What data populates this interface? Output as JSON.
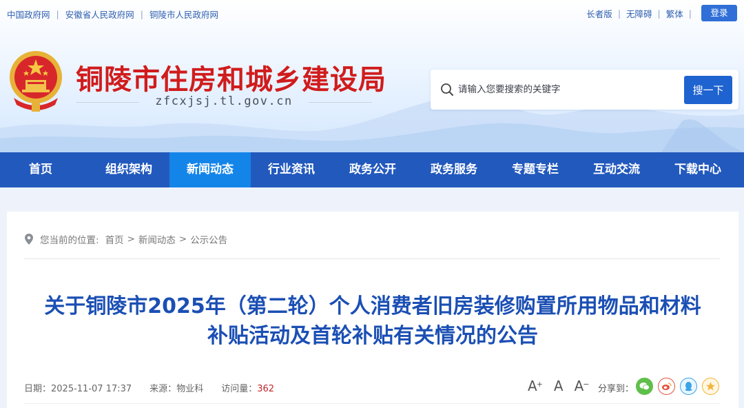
{
  "topbar": {
    "links": [
      "中国政府网",
      "安徽省人民政府网",
      "铜陵市人民政府网"
    ],
    "right_links": [
      "长者版",
      "无障碍",
      "繁体"
    ],
    "login_label": "登录"
  },
  "header": {
    "site_title": "铜陵市住房和城乡建设局",
    "domain": "zfcxjsj.tl.gov.cn",
    "emblem_icon": "national-emblem-icon"
  },
  "search": {
    "placeholder": "请输入您要搜索的关键字",
    "button_label": "搜一下"
  },
  "nav": {
    "items": [
      "首页",
      "组织架构",
      "新闻动态",
      "行业资讯",
      "政务公开",
      "政务服务",
      "专题专栏",
      "互动交流",
      "下载中心"
    ],
    "active_index": 2
  },
  "breadcrumb": {
    "label": "您当前的位置:",
    "items": [
      "首页",
      "新闻动态",
      "公示公告"
    ],
    "separator": ">"
  },
  "article": {
    "title_line1": "关于铜陵市2025年（第二轮）个人消费者旧房装修购置所用物品和材料",
    "title_line2": "补贴活动及首轮补贴有关情况的公告",
    "date_label": "日期：",
    "date": "2025-11-07 17:37",
    "source_label": "来源：",
    "source": "物业科",
    "views_label": "访问量：",
    "views": "362"
  },
  "tools": {
    "font_larger": "A",
    "font_normal": "A",
    "font_smaller": "A",
    "share_label": "分享到：",
    "share_icons": [
      "wechat-icon",
      "weibo-icon",
      "qq-icon",
      "qzone-icon"
    ]
  },
  "colors": {
    "nav_bg": "#2259bd",
    "nav_active": "#1485e8",
    "title_red": "#d01c1c",
    "article_blue": "#1b4fb4",
    "views_red": "#c0272d"
  }
}
